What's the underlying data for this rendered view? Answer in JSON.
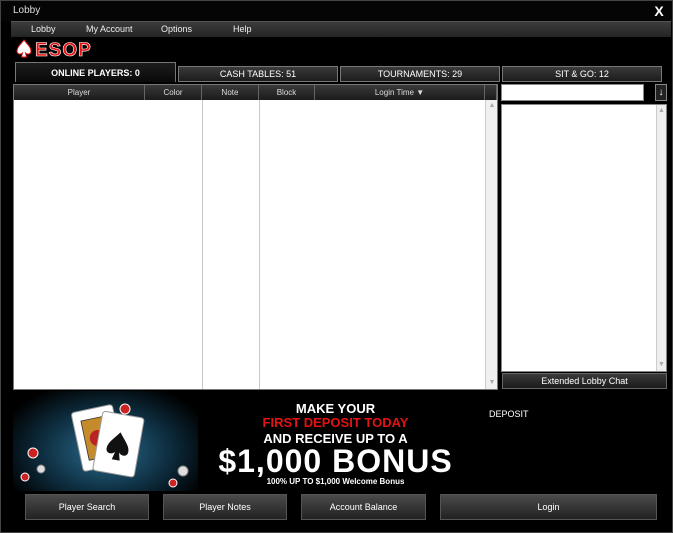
{
  "window": {
    "title": "Lobby",
    "close_glyph": "X"
  },
  "menu": {
    "items": [
      {
        "label": "Lobby"
      },
      {
        "label": "My Account"
      },
      {
        "label": "Options"
      },
      {
        "label": "Help"
      }
    ]
  },
  "brand": {
    "logo_text": "ESOP",
    "logo_color": "#e41212"
  },
  "tabs": [
    {
      "label": "ONLINE PLAYERS: 0",
      "active": true
    },
    {
      "label": "CASH TABLES: 51",
      "active": false
    },
    {
      "label": "TOURNAMENTS: 29",
      "active": false
    },
    {
      "label": "SIT & GO: 12",
      "active": false
    }
  ],
  "player_table": {
    "columns": [
      {
        "label": "Player"
      },
      {
        "label": "Color"
      },
      {
        "label": "Note"
      },
      {
        "label": "Block"
      },
      {
        "label": "Login Time ▼"
      }
    ],
    "rows": []
  },
  "chat": {
    "search_value": "",
    "send_icon": "arrow-down-icon",
    "extended_label": "Extended Lobby Chat"
  },
  "banner": {
    "line1": "MAKE YOUR",
    "line2": "FIRST DEPOSIT TODAY",
    "line3": "AND RECEIVE UP TO A",
    "line4": "$1,000 BONUS",
    "line5": "100% UP TO $1,000 Welcome Bonus",
    "accent_color": "#e41212"
  },
  "deposit": {
    "label": "DEPOSIT"
  },
  "buttons": {
    "player_search": "Player Search",
    "player_notes": "Player Notes",
    "account_balance": "Account Balance",
    "login": "Login"
  }
}
